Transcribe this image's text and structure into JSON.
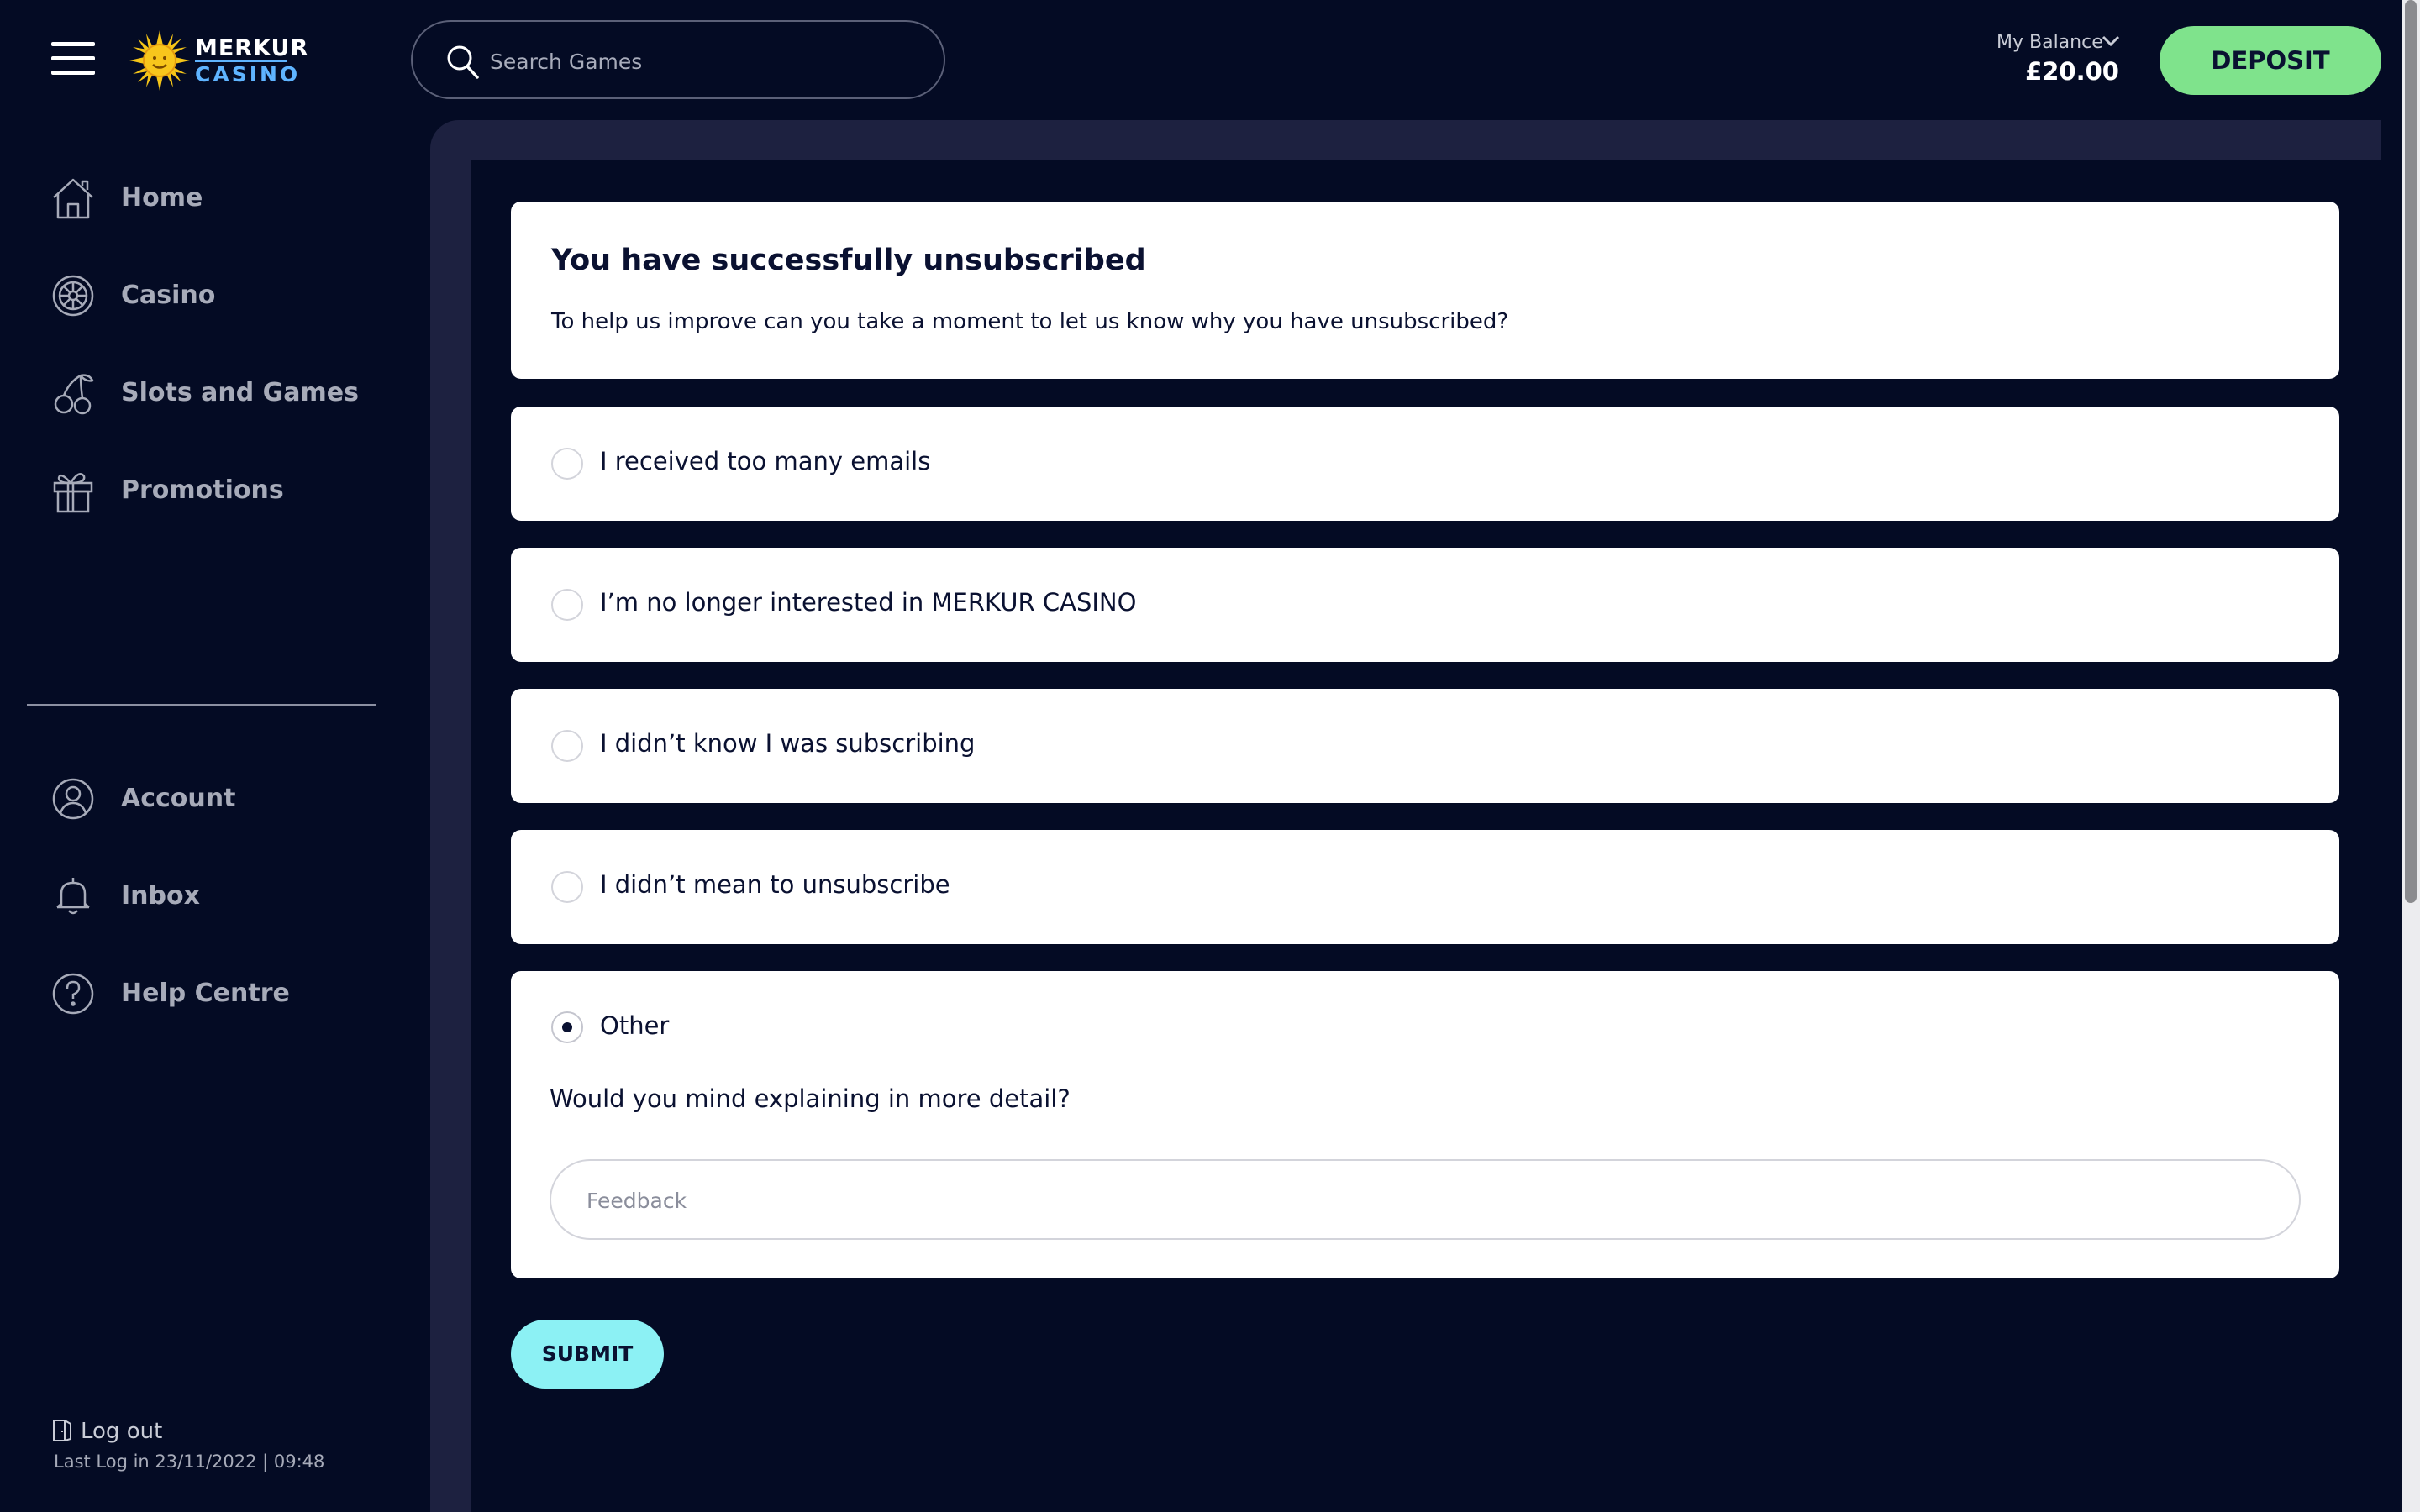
{
  "brand": {
    "line1": "MERKUR",
    "line2": "CASINO"
  },
  "search": {
    "placeholder": "Search Games"
  },
  "balance": {
    "label": "My Balance",
    "value": "£20.00"
  },
  "header": {
    "deposit_label": "DEPOSIT"
  },
  "sidebar": {
    "items": [
      {
        "label": "Home",
        "icon": "home-icon"
      },
      {
        "label": "Casino",
        "icon": "roulette-icon"
      },
      {
        "label": "Slots and Games",
        "icon": "cherries-icon"
      },
      {
        "label": "Promotions",
        "icon": "gift-icon"
      }
    ],
    "account_items": [
      {
        "label": "Account",
        "icon": "user-icon"
      },
      {
        "label": "Inbox",
        "icon": "bell-icon"
      },
      {
        "label": "Help Centre",
        "icon": "question-icon"
      }
    ],
    "logout_label": "Log out",
    "last_login": "Last Log in 23/11/2022 | 09:48"
  },
  "survey": {
    "title": "You have successfully unsubscribed",
    "subtitle": "To help us improve can you take a moment to let us know why you have unsubscribed?",
    "options": [
      {
        "label": "I received too many emails",
        "selected": false
      },
      {
        "label": "I’m no longer interested in MERKUR CASINO",
        "selected": false
      },
      {
        "label": "I didn’t know I was subscribing",
        "selected": false
      },
      {
        "label": "I didn’t mean to unsubscribe",
        "selected": false
      },
      {
        "label": "Other",
        "selected": true
      }
    ],
    "detail_question": "Would you mind explaining in more detail?",
    "feedback_placeholder": "Feedback",
    "feedback_value": "",
    "submit_label": "SUBMIT"
  },
  "colors": {
    "background": "#040b24",
    "panel": "#1d2140",
    "deposit": "#7fe38c",
    "submit": "#8cf1f4",
    "brand_blue": "#5fb4ff"
  }
}
